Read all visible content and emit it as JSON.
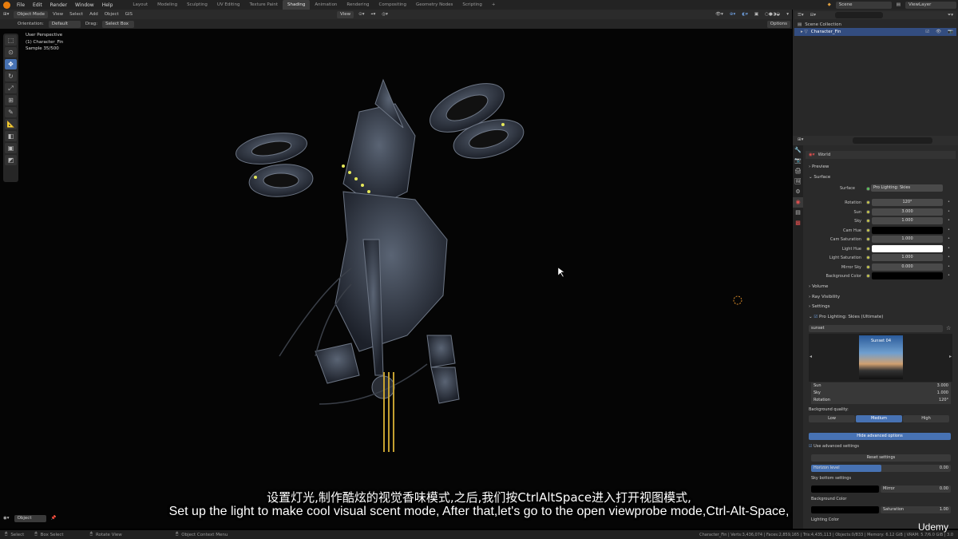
{
  "menu": {
    "items": [
      "File",
      "Edit",
      "Render",
      "Window",
      "Help"
    ],
    "workspaces": [
      "Layout",
      "Modeling",
      "Sculpting",
      "UV Editing",
      "Texture Paint",
      "Shading",
      "Animation",
      "Rendering",
      "Compositing",
      "Geometry Nodes",
      "Scripting"
    ],
    "active_workspace": "Shading",
    "add_tab": "+",
    "scene_label": "Scene",
    "view_layer_label": "ViewLayer"
  },
  "header": {
    "mode": "Object Mode",
    "view": "View",
    "select": "Select",
    "add": "Add",
    "object": "Object",
    "gis": "GIS",
    "view_menu": "View",
    "orientation_label": "Orientation:",
    "orientation_value": "Default",
    "drag_label": "Drag:",
    "drag_value": "Select Box",
    "options": "Options"
  },
  "viewport": {
    "perspective": "User Perspective",
    "object": "(1) Character_Fin",
    "sample": "Sample 35/500"
  },
  "outliner": {
    "collection": "Scene Collection",
    "object": "Character_Fin"
  },
  "properties": {
    "world_name": "World",
    "preview": "Preview",
    "surface_section": "Surface",
    "surface_label": "Surface",
    "surface_value": "Pro Lighting: Skies",
    "fields": [
      {
        "label": "Rotation",
        "value": "120°",
        "type": "num"
      },
      {
        "label": "Sun",
        "value": "3.000",
        "type": "num"
      },
      {
        "label": "Sky",
        "value": "1.000",
        "type": "num"
      },
      {
        "label": "Cam Hue",
        "value": "",
        "type": "black"
      },
      {
        "label": "Cam Saturation",
        "value": "1.000",
        "type": "num"
      },
      {
        "label": "Light Hue",
        "value": "",
        "type": "white"
      },
      {
        "label": "Light Saturation",
        "value": "1.000",
        "type": "num"
      },
      {
        "label": "Mirror Sky",
        "value": "0.000",
        "type": "num"
      },
      {
        "label": "Background Color",
        "value": "",
        "type": "black"
      }
    ],
    "volume": "Volume",
    "ray_visibility": "Ray Visibility",
    "settings": "Settings",
    "addon_title": "Pro Lighting: Skies (Ultimate)",
    "preset": "sunset",
    "thumb_label": "Sunset 04",
    "sky_fields": [
      {
        "label": "Sun",
        "value": "3.000"
      },
      {
        "label": "Sky",
        "value": "1.000"
      },
      {
        "label": "Rotation",
        "value": "120°"
      }
    ],
    "bg_quality_label": "Background quality:",
    "quality": [
      "Low",
      "Medium",
      "High"
    ],
    "quality_selected": "Medium",
    "hide_advanced": "Hide advanced options",
    "use_advanced": "Use advanced settings",
    "reset_settings": "Reset settings",
    "horizon_level": "Horizon level",
    "horizon_value": "0.00",
    "sky_bottom": "Sky bottom settings",
    "mirror": "Mirror",
    "mirror_value": "0.00",
    "background_color": "Background Color",
    "saturation": "Saturation",
    "saturation_value": "1.00",
    "lighting_color": "Lighting Color"
  },
  "bottom_header": {
    "object": "Object"
  },
  "status": {
    "select": "Select",
    "box_select": "Box Select",
    "rotate_view": "Rotate View",
    "context_menu": "Object Context Menu",
    "stats": "Character_Fin | Verts:3,436,074 | Faces:2,859,165 | Tris:4,435,113 | Objects:0/833 | Memory: 6.12 GiB | VRAM: 5.7/6.0 GiB | 3.0"
  },
  "subtitles": {
    "zh": "设置灯光,制作酷炫的视觉香味模式,之后,我们按CtrlAltSpace进入打开视图模式,",
    "en": "Set up the light to make cool visual scent mode, After that,let's go to the open viewprobe mode,Ctrl-Alt-Space,"
  },
  "watermark": "Udemy"
}
